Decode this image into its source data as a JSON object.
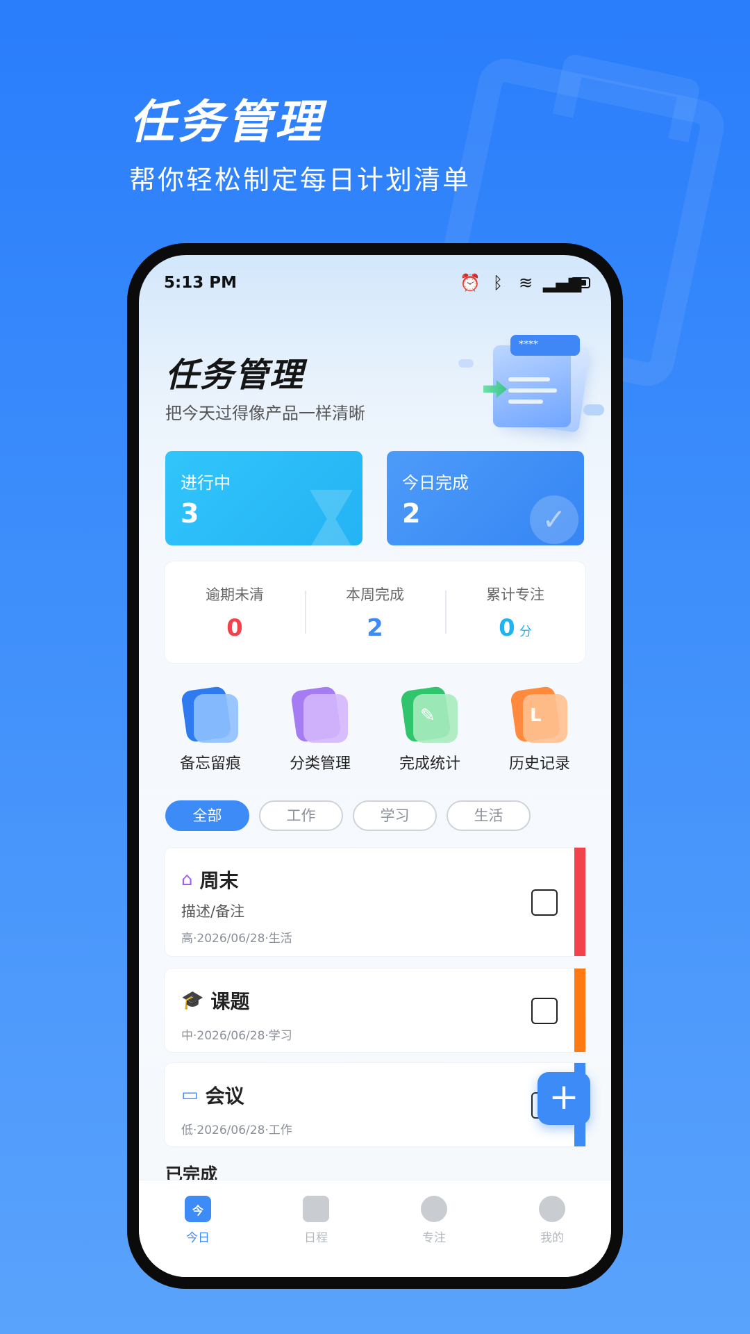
{
  "promo": {
    "title": "任务管理",
    "subtitle": "帮你轻松制定每日计划清单"
  },
  "status_bar": {
    "time": "5:13 PM",
    "icons": [
      "alarm-icon",
      "bluetooth-icon",
      "wifi-icon",
      "signal-icon",
      "battery-icon"
    ]
  },
  "header": {
    "title": "任务管理",
    "subtitle": "把今天过得像产品一样清晰",
    "illustration_badge": "****"
  },
  "stat_cards": [
    {
      "label": "进行中",
      "value": "3",
      "icon": "hourglass-icon"
    },
    {
      "label": "今日完成",
      "value": "2",
      "icon": "check-circle-icon"
    }
  ],
  "summary": [
    {
      "label": "逾期未清",
      "value": "0",
      "unit": "",
      "color": "#f2424b"
    },
    {
      "label": "本周完成",
      "value": "2",
      "unit": "",
      "color": "#3d8bf6"
    },
    {
      "label": "累计专注",
      "value": "0",
      "unit": "分",
      "color": "#1fb3f0"
    }
  ],
  "quick_actions": [
    {
      "label": "备忘留痕",
      "icon": "bookmark-icon"
    },
    {
      "label": "分类管理",
      "icon": "folder-icon"
    },
    {
      "label": "完成统计",
      "icon": "edit-icon"
    },
    {
      "label": "历史记录",
      "icon": "history-icon"
    }
  ],
  "filters": [
    {
      "label": "全部",
      "active": true
    },
    {
      "label": "工作",
      "active": false
    },
    {
      "label": "学习",
      "active": false
    },
    {
      "label": "生活",
      "active": false
    }
  ],
  "tasks": [
    {
      "title": "周末",
      "icon": "home-heart-icon",
      "description": "描述/备注",
      "meta": "高·2026/06/28·生活",
      "priority_color": "#f2424b"
    },
    {
      "title": "课题",
      "icon": "graduation-cap-icon",
      "description": "",
      "meta": "中·2026/06/28·学习",
      "priority_color": "#ff7a12"
    },
    {
      "title": "会议",
      "icon": "monitor-icon",
      "description": "",
      "meta": "低·2026/06/28·工作",
      "priority_color": "#3d8bf6"
    }
  ],
  "completed_header": "已完成",
  "fab": {
    "label": "+"
  },
  "tab_bar": [
    {
      "label": "今日",
      "icon_text": "今",
      "active": true
    },
    {
      "label": "日程",
      "icon_text": "",
      "active": false
    },
    {
      "label": "专注",
      "icon_text": "",
      "active": false
    },
    {
      "label": "我的",
      "icon_text": "",
      "active": false
    }
  ],
  "colors": {
    "accent": "#3d8bf6",
    "cyan": "#24b3f4",
    "background": "#2a7dfb"
  }
}
